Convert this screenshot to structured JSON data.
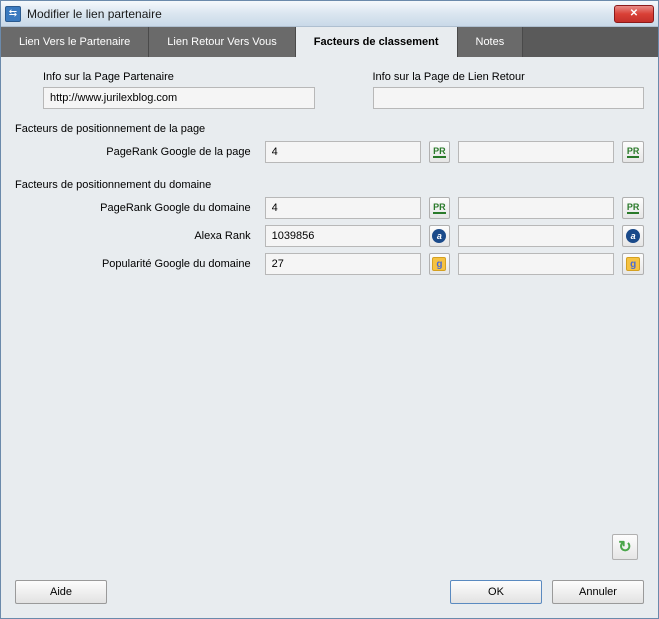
{
  "window": {
    "title": "Modifier le lien partenaire"
  },
  "tabs": {
    "items": [
      {
        "label": "Lien Vers le Partenaire"
      },
      {
        "label": "Lien Retour Vers Vous"
      },
      {
        "label": "Facteurs de classement"
      },
      {
        "label": "Notes"
      }
    ],
    "active": 2
  },
  "info": {
    "partner_label": "Info sur la Page Partenaire",
    "partner_url": "http://www.jurilexblog.com",
    "return_label": "Info sur la Page de Lien Retour",
    "return_url": ""
  },
  "sections": {
    "page_header": "Facteurs de positionnement de la page",
    "domain_header": "Facteurs de positionnement du domaine"
  },
  "factors": {
    "page_pr": {
      "label": "PageRank Google de la page",
      "left": "4",
      "right": ""
    },
    "domain_pr": {
      "label": "PageRank Google du domaine",
      "left": "4",
      "right": ""
    },
    "alexa": {
      "label": "Alexa Rank",
      "left": "1039856",
      "right": ""
    },
    "gpop": {
      "label": "Popularité Google du domaine",
      "left": "27",
      "right": ""
    }
  },
  "buttons": {
    "help": "Aide",
    "ok": "OK",
    "cancel": "Annuler"
  },
  "icons": {
    "pr": "PR",
    "alexa": "a",
    "gpop": "g",
    "refresh": "↻"
  }
}
